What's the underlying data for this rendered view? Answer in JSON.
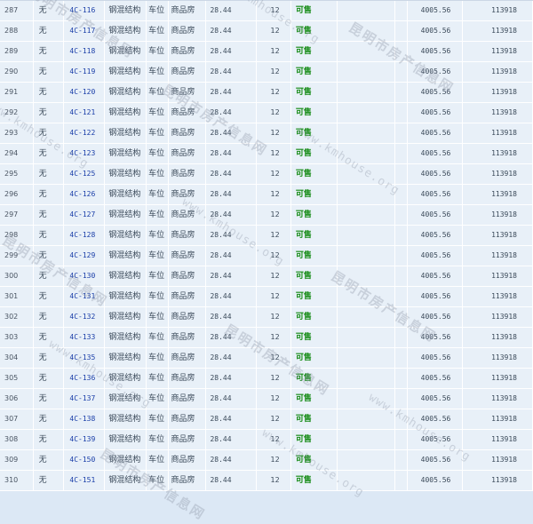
{
  "rows": [
    {
      "idx": "287",
      "house": "无",
      "room": "4C-116",
      "structure": "钢混结构",
      "use": "车位",
      "type": "商品房",
      "area": "28.44",
      "floor": "12",
      "status": "可售",
      "price": "4005.56",
      "total": "113918"
    },
    {
      "idx": "288",
      "house": "无",
      "room": "4C-117",
      "structure": "钢混结构",
      "use": "车位",
      "type": "商品房",
      "area": "28.44",
      "floor": "12",
      "status": "可售",
      "price": "4005.56",
      "total": "113918"
    },
    {
      "idx": "289",
      "house": "无",
      "room": "4C-118",
      "structure": "钢混结构",
      "use": "车位",
      "type": "商品房",
      "area": "28.44",
      "floor": "12",
      "status": "可售",
      "price": "4005.56",
      "total": "113918"
    },
    {
      "idx": "290",
      "house": "无",
      "room": "4C-119",
      "structure": "钢混结构",
      "use": "车位",
      "type": "商品房",
      "area": "28.44",
      "floor": "12",
      "status": "可售",
      "price": "4005.56",
      "total": "113918"
    },
    {
      "idx": "291",
      "house": "无",
      "room": "4C-120",
      "structure": "钢混结构",
      "use": "车位",
      "type": "商品房",
      "area": "28.44",
      "floor": "12",
      "status": "可售",
      "price": "4005.56",
      "total": "113918"
    },
    {
      "idx": "292",
      "house": "无",
      "room": "4C-121",
      "structure": "钢混结构",
      "use": "车位",
      "type": "商品房",
      "area": "28.44",
      "floor": "12",
      "status": "可售",
      "price": "4005.56",
      "total": "113918"
    },
    {
      "idx": "293",
      "house": "无",
      "room": "4C-122",
      "structure": "钢混结构",
      "use": "车位",
      "type": "商品房",
      "area": "28.44",
      "floor": "12",
      "status": "可售",
      "price": "4005.56",
      "total": "113918"
    },
    {
      "idx": "294",
      "house": "无",
      "room": "4C-123",
      "structure": "钢混结构",
      "use": "车位",
      "type": "商品房",
      "area": "28.44",
      "floor": "12",
      "status": "可售",
      "price": "4005.56",
      "total": "113918"
    },
    {
      "idx": "295",
      "house": "无",
      "room": "4C-125",
      "structure": "钢混结构",
      "use": "车位",
      "type": "商品房",
      "area": "28.44",
      "floor": "12",
      "status": "可售",
      "price": "4005.56",
      "total": "113918"
    },
    {
      "idx": "296",
      "house": "无",
      "room": "4C-126",
      "structure": "钢混结构",
      "use": "车位",
      "type": "商品房",
      "area": "28.44",
      "floor": "12",
      "status": "可售",
      "price": "4005.56",
      "total": "113918"
    },
    {
      "idx": "297",
      "house": "无",
      "room": "4C-127",
      "structure": "钢混结构",
      "use": "车位",
      "type": "商品房",
      "area": "28.44",
      "floor": "12",
      "status": "可售",
      "price": "4005.56",
      "total": "113918"
    },
    {
      "idx": "298",
      "house": "无",
      "room": "4C-128",
      "structure": "钢混结构",
      "use": "车位",
      "type": "商品房",
      "area": "28.44",
      "floor": "12",
      "status": "可售",
      "price": "4005.56",
      "total": "113918"
    },
    {
      "idx": "299",
      "house": "无",
      "room": "4C-129",
      "structure": "钢混结构",
      "use": "车位",
      "type": "商品房",
      "area": "28.44",
      "floor": "12",
      "status": "可售",
      "price": "4005.56",
      "total": "113918"
    },
    {
      "idx": "300",
      "house": "无",
      "room": "4C-130",
      "structure": "钢混结构",
      "use": "车位",
      "type": "商品房",
      "area": "28.44",
      "floor": "12",
      "status": "可售",
      "price": "4005.56",
      "total": "113918"
    },
    {
      "idx": "301",
      "house": "无",
      "room": "4C-131",
      "structure": "钢混结构",
      "use": "车位",
      "type": "商品房",
      "area": "28.44",
      "floor": "12",
      "status": "可售",
      "price": "4005.56",
      "total": "113918"
    },
    {
      "idx": "302",
      "house": "无",
      "room": "4C-132",
      "structure": "钢混结构",
      "use": "车位",
      "type": "商品房",
      "area": "28.44",
      "floor": "12",
      "status": "可售",
      "price": "4005.56",
      "total": "113918"
    },
    {
      "idx": "303",
      "house": "无",
      "room": "4C-133",
      "structure": "钢混结构",
      "use": "车位",
      "type": "商品房",
      "area": "28.44",
      "floor": "12",
      "status": "可售",
      "price": "4005.56",
      "total": "113918"
    },
    {
      "idx": "304",
      "house": "无",
      "room": "4C-135",
      "structure": "钢混结构",
      "use": "车位",
      "type": "商品房",
      "area": "28.44",
      "floor": "12",
      "status": "可售",
      "price": "4005.56",
      "total": "113918"
    },
    {
      "idx": "305",
      "house": "无",
      "room": "4C-136",
      "structure": "钢混结构",
      "use": "车位",
      "type": "商品房",
      "area": "28.44",
      "floor": "12",
      "status": "可售",
      "price": "4005.56",
      "total": "113918"
    },
    {
      "idx": "306",
      "house": "无",
      "room": "4C-137",
      "structure": "钢混结构",
      "use": "车位",
      "type": "商品房",
      "area": "28.44",
      "floor": "12",
      "status": "可售",
      "price": "4005.56",
      "total": "113918"
    },
    {
      "idx": "307",
      "house": "无",
      "room": "4C-138",
      "structure": "钢混结构",
      "use": "车位",
      "type": "商品房",
      "area": "28.44",
      "floor": "12",
      "status": "可售",
      "price": "4005.56",
      "total": "113918"
    },
    {
      "idx": "308",
      "house": "无",
      "room": "4C-139",
      "structure": "钢混结构",
      "use": "车位",
      "type": "商品房",
      "area": "28.44",
      "floor": "12",
      "status": "可售",
      "price": "4005.56",
      "total": "113918"
    },
    {
      "idx": "309",
      "house": "无",
      "room": "4C-150",
      "structure": "钢混结构",
      "use": "车位",
      "type": "商品房",
      "area": "28.44",
      "floor": "12",
      "status": "可售",
      "price": "4005.56",
      "total": "113918"
    },
    {
      "idx": "310",
      "house": "无",
      "room": "4C-151",
      "structure": "钢混结构",
      "use": "车位",
      "type": "商品房",
      "area": "28.44",
      "floor": "12",
      "status": "可售",
      "price": "4005.56",
      "total": "113918"
    }
  ],
  "watermark": {
    "cn": "昆明市房产信息网",
    "en": "www.kmhouse.org"
  },
  "colors": {
    "background": "#dce8f5",
    "row": "#e8f0f8",
    "room_link": "#1a3ea8",
    "status_available": "#148a14"
  }
}
